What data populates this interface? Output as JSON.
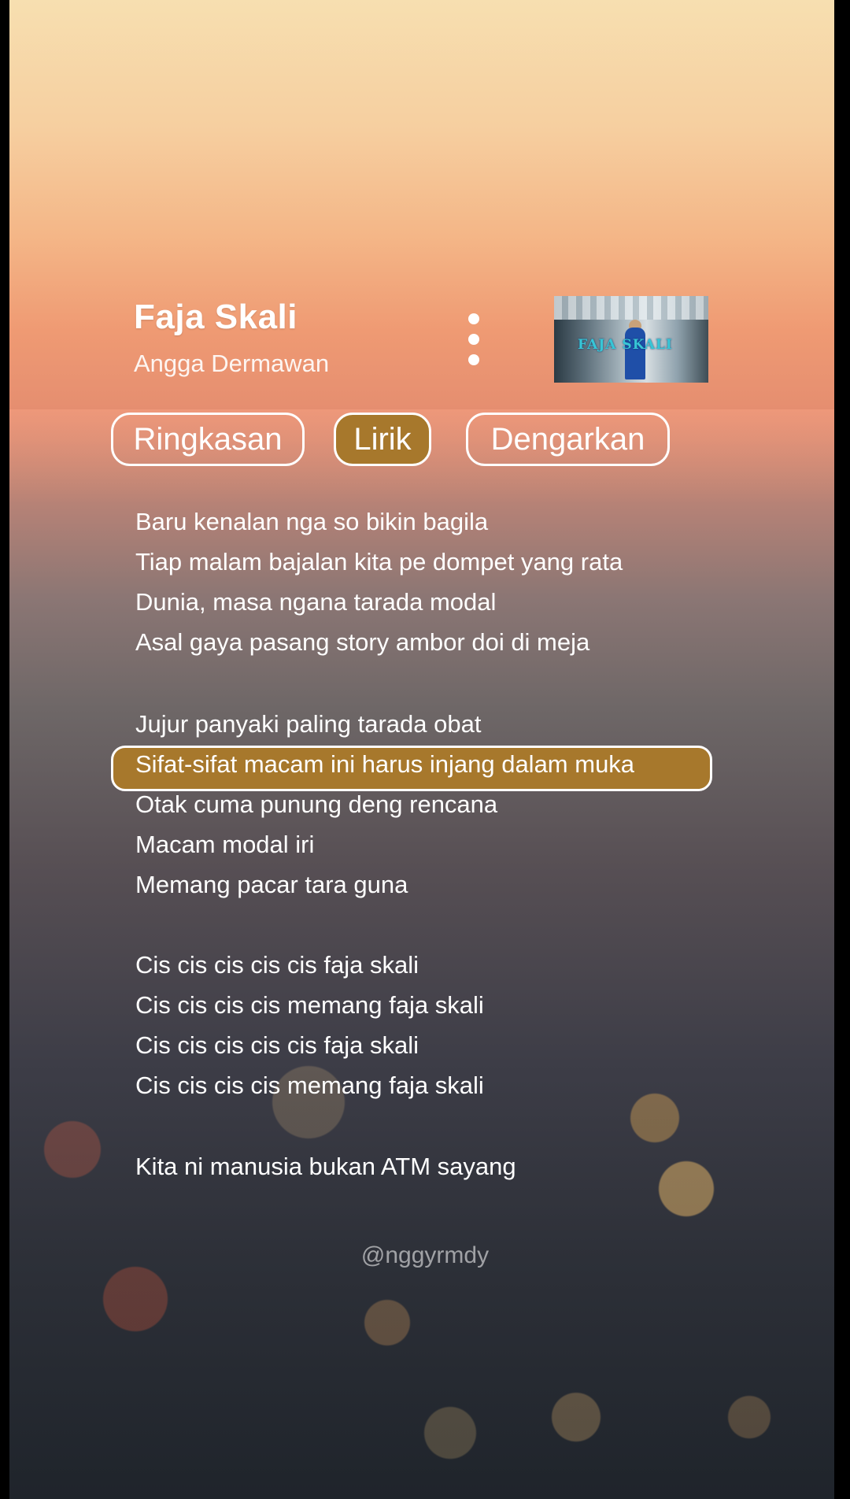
{
  "song": {
    "title": "Faja Skali",
    "artist": "Angga Dermawan",
    "thumbnail_text": "FAJA SKALI"
  },
  "tabs": [
    {
      "label": "Ringkasan",
      "active": false
    },
    {
      "label": "Lirik",
      "active": true
    },
    {
      "label": "Dengarkan",
      "active": false
    }
  ],
  "lyrics": {
    "lines": [
      "Baru kenalan nga so bikin bagila",
      "Tiap malam bajalan kita pe dompet yang rata",
      "Dunia, masa ngana tarada modal",
      "Asal gaya pasang story ambor doi di meja",
      "Jujur panyaki paling tarada obat",
      "Sifat-sifat macam ini harus injang dalam muka",
      "Otak cuma punung deng rencana",
      "Macam modal iri",
      "Memang pacar tara guna",
      "Cis cis cis cis cis faja skali",
      "Cis cis cis cis memang faja skali",
      "Cis cis cis cis cis faja skali",
      "Cis cis cis cis memang faja skali",
      "Kita ni manusia bukan ATM sayang"
    ],
    "current_index": 5
  },
  "watermark": "@nggyrmdy",
  "colors": {
    "accent": "#a7782c",
    "text": "#ffffff"
  },
  "icons": {
    "more": "more-vertical-icon"
  }
}
